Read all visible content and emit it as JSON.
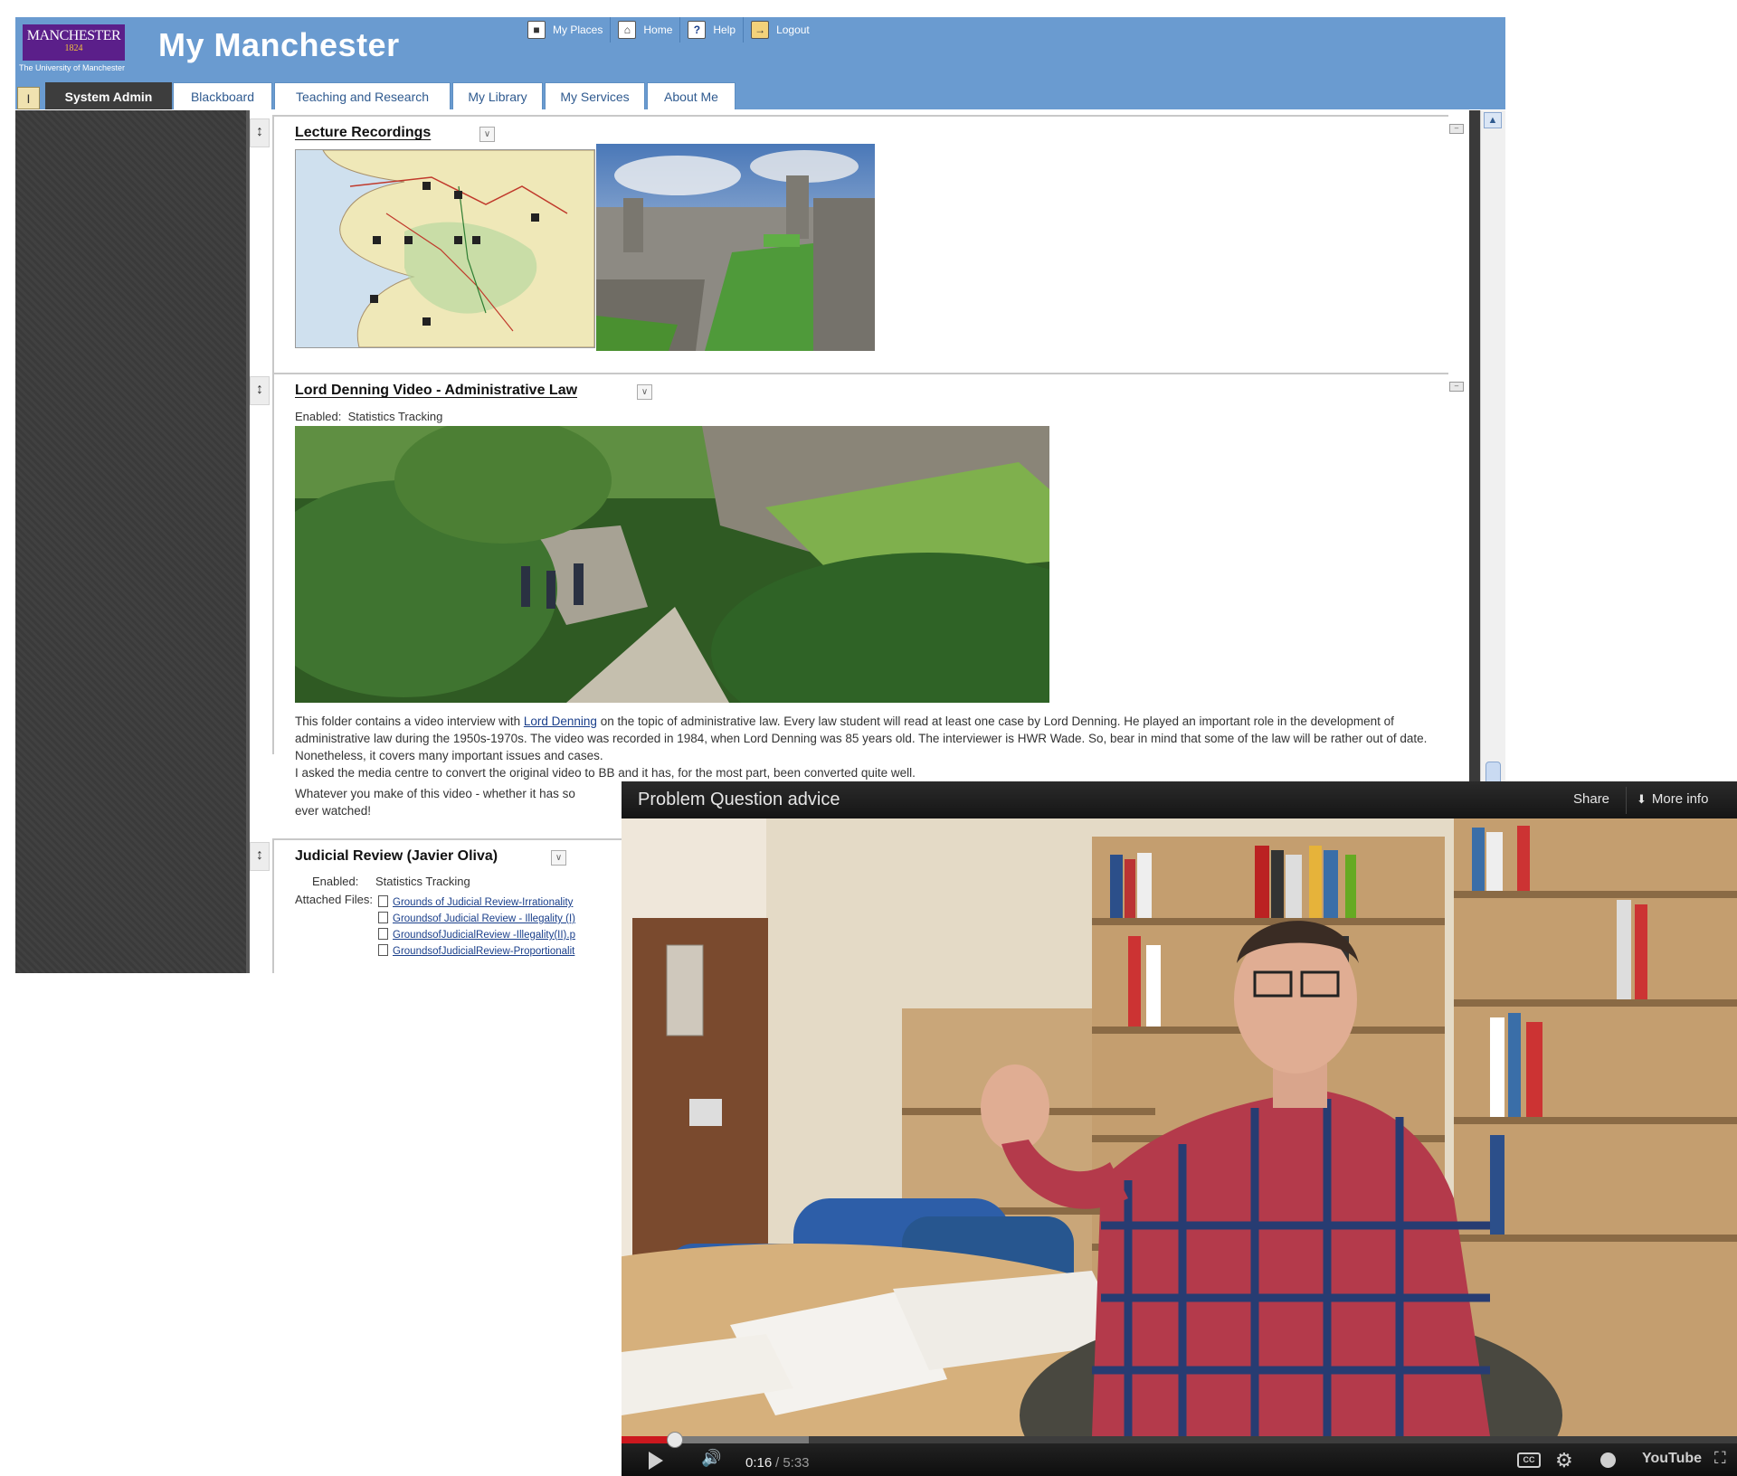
{
  "portal": {
    "logo": {
      "name": "MANCHESTER",
      "year": "1824",
      "university": "The University of Manchester"
    },
    "title": "My Manchester",
    "top_links": [
      {
        "label": "My Places",
        "icon": "building-icon"
      },
      {
        "label": "Home",
        "icon": "home-icon"
      },
      {
        "label": "Help",
        "icon": "help-icon"
      },
      {
        "label": "Logout",
        "icon": "logout-icon"
      }
    ],
    "customize_icon": "I",
    "tabs": [
      {
        "label": "System Admin",
        "active": true
      },
      {
        "label": "Blackboard",
        "active": false
      },
      {
        "label": "Teaching and Research",
        "active": false
      },
      {
        "label": "My Library",
        "active": false
      },
      {
        "label": "My Services",
        "active": false
      },
      {
        "label": "About Me",
        "active": false
      }
    ],
    "modules": [
      {
        "title": "Lecture Recordings",
        "images": [
          "wales-castles-map",
          "castle-aerial-photo"
        ]
      },
      {
        "title": "Lord Denning Video - Administrative Law",
        "enabled_label": "Enabled:",
        "enabled_value": "Statistics Tracking",
        "image": "castle-ruins-walkers-photo",
        "para1_before": "This folder contains a video interview with ",
        "para1_link": "Lord Denning",
        "para1_after": " on the topic of administrative law. Every law student will read at least one case by Lord Denning. He played an important role in the development of administrative law during the 1950s-1970s. The video was recorded in 1984, when Lord Denning was 85 years old. The interviewer is HWR Wade. So, bear in mind that some of the law will be rather out of date. Nonetheless, it covers many important issues and cases.",
        "para2": "I asked the media centre to convert the original video to BB and it has, for the most part, been converted quite well.",
        "para3": "Whatever you make of this video - whether it has so",
        "para3_end": "ever watched!"
      },
      {
        "title": "Judicial Review (Javier Oliva)",
        "enabled_label": "Enabled:",
        "enabled_value": "Statistics Tracking",
        "attached_label": "Attached Files:",
        "files": [
          "Grounds of Judicial Review-Irrationality",
          "Groundsof Judicial Review - Illegality (I)",
          "GroundsofJudicialReview -Illegality(II).p",
          "GroundsofJudicialReview-Proportionalit"
        ]
      }
    ]
  },
  "player": {
    "title": "Problem Question advice",
    "share_label": "Share",
    "more_info_label": "More info",
    "time_current": "0:16",
    "time_total": "/ 5:33",
    "played_fraction": 0.048,
    "buffered_fraction": 0.168,
    "accent_color": "#cc181e",
    "control_icons": [
      "play-icon",
      "volume-icon",
      "captions-icon",
      "settings-icon",
      "watch-later-icon",
      "youtube-logo",
      "fullscreen-icon"
    ],
    "youtube_logo": "YouTube"
  }
}
